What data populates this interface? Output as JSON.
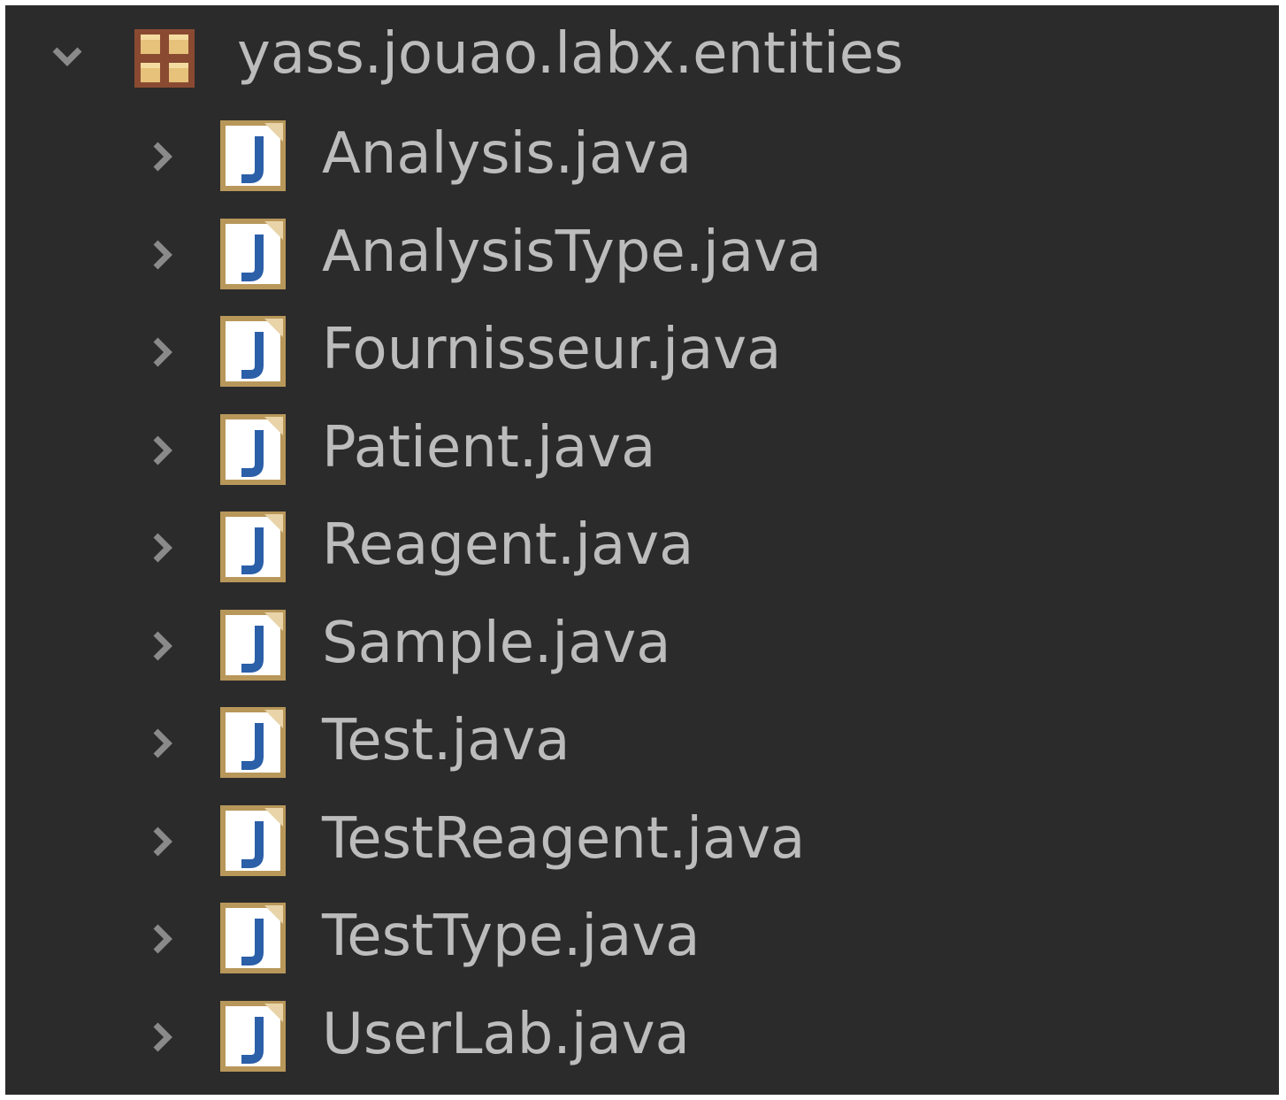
{
  "package": {
    "name": "yass.jouao.labx.entities",
    "expanded": true,
    "icon": "package-icon"
  },
  "files": [
    {
      "label": "Analysis.java",
      "icon": "java-file-icon"
    },
    {
      "label": "AnalysisType.java",
      "icon": "java-file-icon"
    },
    {
      "label": "Fournisseur.java",
      "icon": "java-file-icon"
    },
    {
      "label": "Patient.java",
      "icon": "java-file-icon"
    },
    {
      "label": "Reagent.java",
      "icon": "java-file-icon"
    },
    {
      "label": "Sample.java",
      "icon": "java-file-icon"
    },
    {
      "label": "Test.java",
      "icon": "java-file-icon"
    },
    {
      "label": "TestReagent.java",
      "icon": "java-file-icon"
    },
    {
      "label": "TestType.java",
      "icon": "java-file-icon"
    },
    {
      "label": "UserLab.java",
      "icon": "java-file-icon"
    }
  ],
  "colors": {
    "background": "#2b2b2b",
    "text": "#bcbcbc",
    "arrow": "#8a8a8a",
    "file_icon_border": "#b8975a",
    "file_icon_fill": "#ffffff",
    "java_letter": "#2b5fa8",
    "package_icon": "#c8a064"
  }
}
